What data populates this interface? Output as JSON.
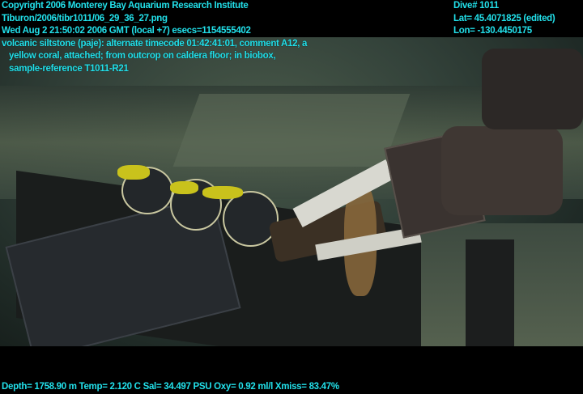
{
  "overlay": {
    "top_left": {
      "copyright": "Copyright 2006 Monterey Bay Aquarium Research Institute",
      "file_path": "Tiburon/2006/tibr1011/06_29_36_27.png",
      "datetime": "Wed Aug  2 21:50:02 2006 GMT (local +7)  esecs=1154555402",
      "annotation_line1": "volcanic siltstone (paje): alternate timecode 01:42:41:01, comment A12, a",
      "annotation_line2": "yellow coral, attached; from outcrop on caldera floor; in biobox,",
      "annotation_line3": "sample-reference T1011-R21"
    },
    "top_right": {
      "dive": "Dive# 1011",
      "lat": "Lat= 45.4071825 (edited)",
      "lon": "Lon= -130.4450175"
    },
    "bottom": {
      "sensors": "Depth= 1758.90 m  Temp= 2.120 C  Sal= 34.497 PSU  Oxy= 0.92 ml/l  Xmiss= 83.47%"
    }
  },
  "colors": {
    "overlay_text": "#22e0ea",
    "background": "#000000"
  }
}
